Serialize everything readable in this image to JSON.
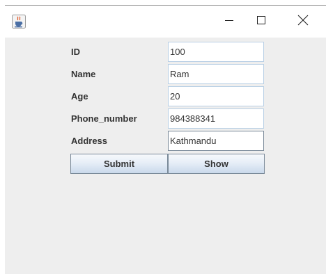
{
  "window": {
    "icons": {
      "app": "java-cup-icon",
      "minimize": "minimize-icon",
      "maximize": "maximize-icon",
      "close": "close-icon"
    }
  },
  "form": {
    "fields": [
      {
        "label": "ID",
        "value": "100"
      },
      {
        "label": "Name",
        "value": "Ram"
      },
      {
        "label": "Age",
        "value": "20"
      },
      {
        "label": "Phone_number",
        "value": "984388341"
      },
      {
        "label": "Address",
        "value": "Kathmandu"
      }
    ],
    "submit_label": "Submit",
    "show_label": "Show"
  }
}
